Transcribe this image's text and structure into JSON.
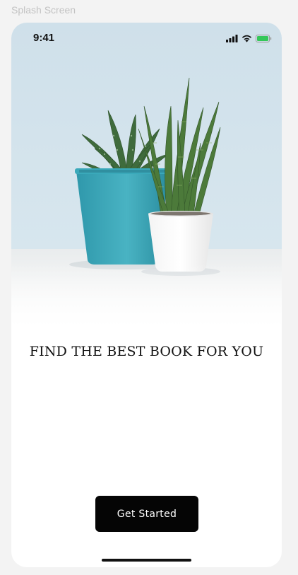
{
  "frame": {
    "label": "Splash Screen"
  },
  "status_bar": {
    "time": "9:41"
  },
  "hero": {
    "image_description_icon": "potted-plants-image"
  },
  "content": {
    "headline": "FIND THE BEST BOOK FOR YOU"
  },
  "actions": {
    "get_started_label": "Get Started"
  },
  "colors": {
    "background": "#f3f3f3",
    "screen": "#ffffff",
    "button": "#050505",
    "button_text": "#ffffff",
    "battery": "#34c759",
    "wall": "#cfe1ea",
    "pot_teal": "#3aa6b7",
    "pot_white": "#ffffff"
  }
}
